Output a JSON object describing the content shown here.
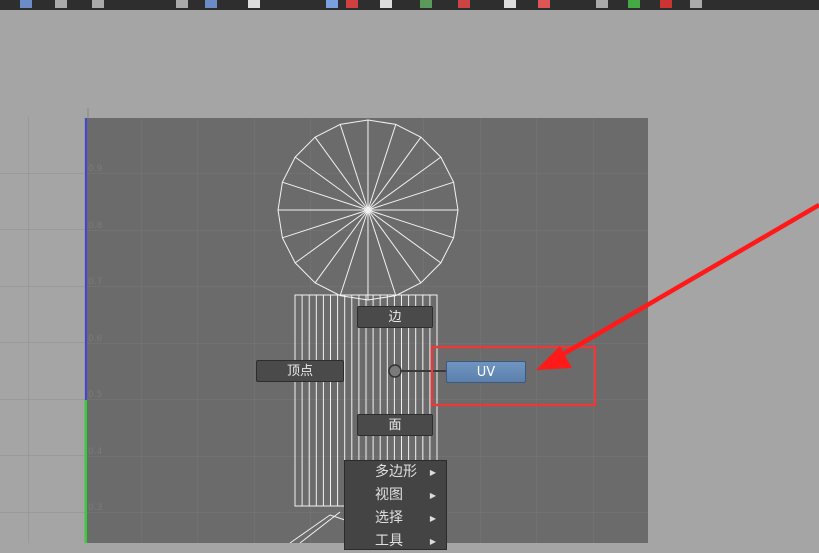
{
  "toolbar": {
    "icons": [
      "uv-tool-icon",
      "move-icon",
      "dots-icon",
      "frame-icon",
      "snap-icon",
      "document-icon",
      "checker-icon",
      "color-icon",
      "shade-icon",
      "grid-icon",
      "pin-icon",
      "light-icon",
      "cut-icon",
      "sew-icon",
      "vertex-icon",
      "edge-icon",
      "face-icon"
    ]
  },
  "axis_labels": [
    "0.9",
    "0.8",
    "0.7",
    "0.6",
    "0.5",
    "0.4",
    "0.3"
  ],
  "marking_menu": {
    "edge": "边",
    "vertex": "顶点",
    "uv": "UV",
    "face": "面"
  },
  "submenu": {
    "items": [
      {
        "label": "多边形"
      },
      {
        "label": "视图"
      },
      {
        "label": "选择"
      },
      {
        "label": "工具"
      }
    ]
  },
  "colors": {
    "background": "#a5a5a5",
    "uv_grid": "#6b6b6b",
    "highlight_box": "#e53b3b",
    "arrow": "#ff1a1a",
    "v_axis": "#4444dd",
    "u_axis": "#22dd22"
  }
}
